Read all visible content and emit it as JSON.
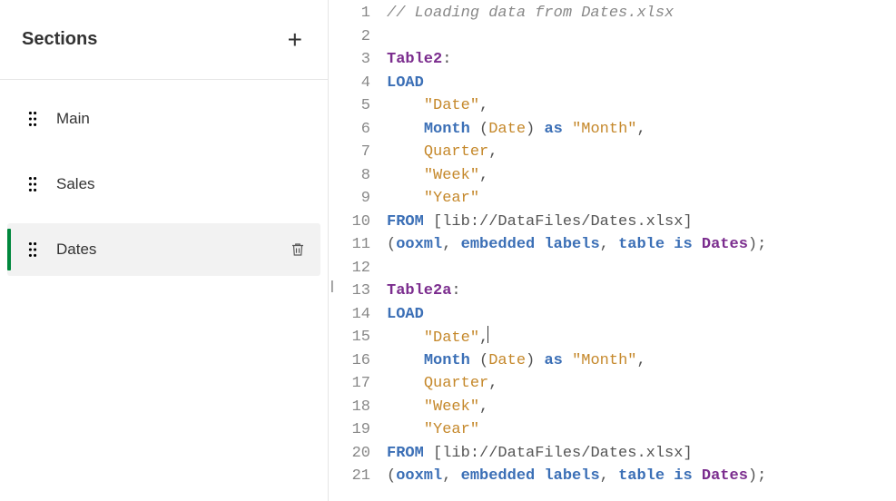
{
  "sidebar": {
    "title": "Sections",
    "add_icon": "+",
    "items": [
      {
        "label": "Main",
        "active": false
      },
      {
        "label": "Sales",
        "active": false
      },
      {
        "label": "Dates",
        "active": true
      }
    ]
  },
  "editor": {
    "line_count": 21,
    "cursor_line": 15,
    "lines": [
      {
        "tokens": [
          {
            "t": "// Loading data from Dates.xlsx",
            "c": "comment"
          }
        ]
      },
      {
        "tokens": []
      },
      {
        "tokens": [
          {
            "t": "Table2",
            "c": "ident"
          },
          {
            "t": ":",
            "c": "plain"
          }
        ]
      },
      {
        "tokens": [
          {
            "t": "LOAD",
            "c": "kw"
          }
        ]
      },
      {
        "tokens": [
          {
            "t": "    ",
            "c": "plain"
          },
          {
            "t": "\"Date\"",
            "c": "str"
          },
          {
            "t": ",",
            "c": "plain"
          }
        ]
      },
      {
        "tokens": [
          {
            "t": "    ",
            "c": "plain"
          },
          {
            "t": "Month",
            "c": "fn"
          },
          {
            "t": " (",
            "c": "plain"
          },
          {
            "t": "Date",
            "c": "arg"
          },
          {
            "t": ") ",
            "c": "plain"
          },
          {
            "t": "as",
            "c": "op"
          },
          {
            "t": " ",
            "c": "plain"
          },
          {
            "t": "\"Month\"",
            "c": "str"
          },
          {
            "t": ",",
            "c": "plain"
          }
        ]
      },
      {
        "tokens": [
          {
            "t": "    ",
            "c": "plain"
          },
          {
            "t": "Quarter",
            "c": "arg"
          },
          {
            "t": ",",
            "c": "plain"
          }
        ]
      },
      {
        "tokens": [
          {
            "t": "    ",
            "c": "plain"
          },
          {
            "t": "\"Week\"",
            "c": "str"
          },
          {
            "t": ",",
            "c": "plain"
          }
        ]
      },
      {
        "tokens": [
          {
            "t": "    ",
            "c": "plain"
          },
          {
            "t": "\"Year\"",
            "c": "str"
          }
        ]
      },
      {
        "tokens": [
          {
            "t": "FROM",
            "c": "kw"
          },
          {
            "t": " [",
            "c": "plain"
          },
          {
            "t": "lib://DataFiles/Dates.xlsx",
            "c": "path"
          },
          {
            "t": "]",
            "c": "plain"
          }
        ]
      },
      {
        "tokens": [
          {
            "t": "(",
            "c": "plain"
          },
          {
            "t": "ooxml",
            "c": "kw"
          },
          {
            "t": ", ",
            "c": "plain"
          },
          {
            "t": "embedded labels",
            "c": "kw"
          },
          {
            "t": ", ",
            "c": "plain"
          },
          {
            "t": "table is",
            "c": "kw"
          },
          {
            "t": " ",
            "c": "plain"
          },
          {
            "t": "Dates",
            "c": "ident"
          },
          {
            "t": ");",
            "c": "plain"
          }
        ]
      },
      {
        "tokens": []
      },
      {
        "tokens": [
          {
            "t": "Table2a",
            "c": "ident"
          },
          {
            "t": ":",
            "c": "plain"
          }
        ]
      },
      {
        "tokens": [
          {
            "t": "LOAD",
            "c": "kw"
          }
        ]
      },
      {
        "tokens": [
          {
            "t": "    ",
            "c": "plain"
          },
          {
            "t": "\"Date\"",
            "c": "str"
          },
          {
            "t": ",",
            "c": "plain"
          }
        ],
        "cursor_after": true
      },
      {
        "tokens": [
          {
            "t": "    ",
            "c": "plain"
          },
          {
            "t": "Month",
            "c": "fn"
          },
          {
            "t": " (",
            "c": "plain"
          },
          {
            "t": "Date",
            "c": "arg"
          },
          {
            "t": ") ",
            "c": "plain"
          },
          {
            "t": "as",
            "c": "op"
          },
          {
            "t": " ",
            "c": "plain"
          },
          {
            "t": "\"Month\"",
            "c": "str"
          },
          {
            "t": ",",
            "c": "plain"
          }
        ]
      },
      {
        "tokens": [
          {
            "t": "    ",
            "c": "plain"
          },
          {
            "t": "Quarter",
            "c": "arg"
          },
          {
            "t": ",",
            "c": "plain"
          }
        ]
      },
      {
        "tokens": [
          {
            "t": "    ",
            "c": "plain"
          },
          {
            "t": "\"Week\"",
            "c": "str"
          },
          {
            "t": ",",
            "c": "plain"
          }
        ]
      },
      {
        "tokens": [
          {
            "t": "    ",
            "c": "plain"
          },
          {
            "t": "\"Year\"",
            "c": "str"
          }
        ]
      },
      {
        "tokens": [
          {
            "t": "FROM",
            "c": "kw"
          },
          {
            "t": " [",
            "c": "plain"
          },
          {
            "t": "lib://DataFiles/Dates.xlsx",
            "c": "path"
          },
          {
            "t": "]",
            "c": "plain"
          }
        ]
      },
      {
        "tokens": [
          {
            "t": "(",
            "c": "plain"
          },
          {
            "t": "ooxml",
            "c": "kw"
          },
          {
            "t": ", ",
            "c": "plain"
          },
          {
            "t": "embedded labels",
            "c": "kw"
          },
          {
            "t": ", ",
            "c": "plain"
          },
          {
            "t": "table is",
            "c": "kw"
          },
          {
            "t": " ",
            "c": "plain"
          },
          {
            "t": "Dates",
            "c": "ident"
          },
          {
            "t": ");",
            "c": "plain"
          }
        ]
      }
    ]
  }
}
